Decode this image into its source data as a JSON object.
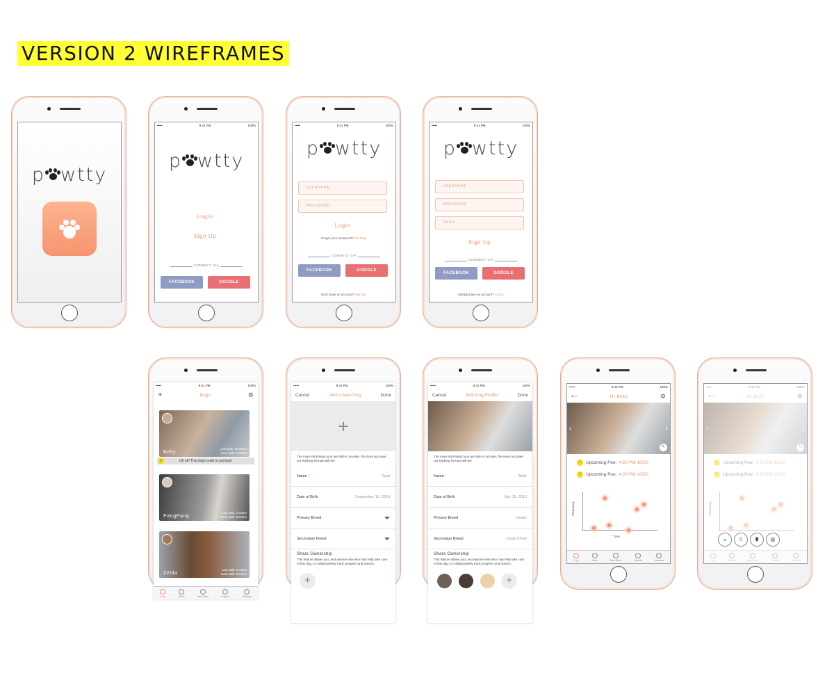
{
  "heading": "VERSION 2 WIREFRAMES",
  "status": {
    "time": "9:41 PM",
    "battery": "100%",
    "signal": "•••••"
  },
  "logo_text": {
    "p": "p",
    "rest": "wtty"
  },
  "auth": {
    "login": "Login",
    "signup": "Sign Up",
    "connect_via": "CONNECT VIA",
    "facebook": "FACEBOOK",
    "google": "GOOGLE",
    "username": "USERNAME",
    "password": "PASSWORD",
    "email": "EMAIL",
    "forgot": "Forgot your password?",
    "get_help": "Get help.",
    "no_account": "Don't have an account?",
    "signup_link": "Sign Up.",
    "have_account": "Already have an account?",
    "login_link": "Log in."
  },
  "dogs_screen": {
    "title": "Dogs",
    "dogs": [
      {
        "name": "Belly",
        "last_walk": "Last walk:  12:30pm",
        "next_walk": "Next walk:  5:30pm"
      },
      {
        "name": "PangPang",
        "last_walk": "Last walk:  2:14pm",
        "next_walk": "Next walk:  8:25pm"
      },
      {
        "name": "Zelda",
        "last_walk": "Last walk:  2:14pm",
        "next_walk": "Next walk:  8:25pm"
      }
    ],
    "alert": "Uh oh! This dog's walk is overdue!"
  },
  "tabs": [
    "Dogs",
    "Alerts",
    "New Entry",
    "Friends",
    "Vanessa"
  ],
  "add_dog": {
    "cancel": "Cancel",
    "title": "Add a New Dog",
    "done": "Done",
    "info": "The more information you are able to provide, the more accurate our tracking formula will be!",
    "fields": [
      {
        "label": "Name",
        "value": "Spot"
      },
      {
        "label": "Date of Birth",
        "value": "September 10, 2010"
      },
      {
        "label": "Primary Breed",
        "value": ""
      },
      {
        "label": "Secondary Breed",
        "value": ""
      }
    ],
    "share_title": "Share Ownership",
    "share_text": "This feature allows you, and anyone else who may help take care of this dog, to collaboratively track progress and actions."
  },
  "edit_dog": {
    "cancel": "Cancel",
    "title": "Edit Dog Profile",
    "done": "Done",
    "fields": [
      {
        "label": "Name",
        "value": "Belly"
      },
      {
        "label": "Date of Birth",
        "value": "July 15, 2013"
      },
      {
        "label": "Primary Breed",
        "value": "Husky"
      },
      {
        "label": "Secondary Breed",
        "value": "Chow Chow"
      }
    ]
  },
  "home": {
    "greeting": "Hi, Belly!",
    "pee_label": "Upcoming Pee:",
    "pee_time": "4:20 PM 10/20",
    "poo_label": "Upcoming Poo:",
    "poo_time": "4:20 PM 10/20",
    "ylabel": "Frequency",
    "xlabel": "Time"
  },
  "colors": {
    "accent": "#f5956c",
    "facebook": "#8e9bc4",
    "google": "#e86f72",
    "highlight": "#ffff33"
  }
}
